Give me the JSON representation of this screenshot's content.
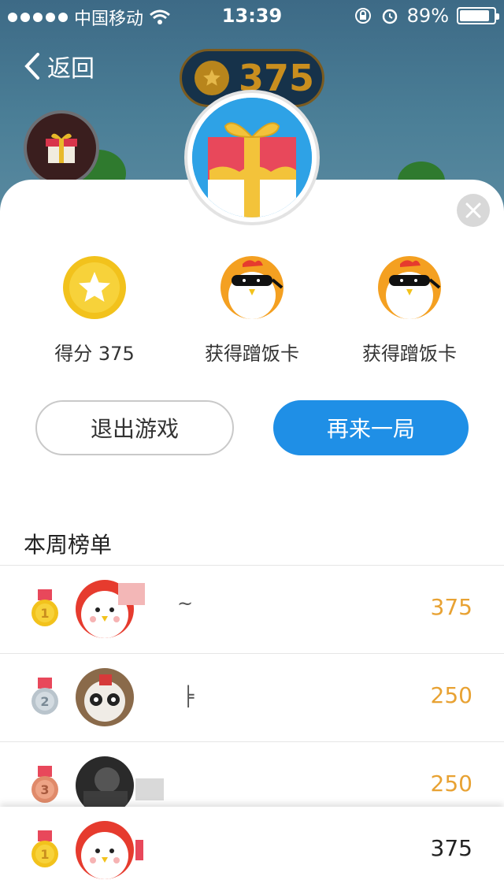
{
  "status_bar": {
    "carrier": "中国移动",
    "time": "13:39",
    "battery": "89%",
    "battery_level": 0.89
  },
  "nav": {
    "back_label": "返回",
    "coin_score": "375"
  },
  "rewards": [
    {
      "label": "得分 375",
      "icon": "star-coin-icon"
    },
    {
      "label": "获得蹭饭卡",
      "icon": "chicken-mask-icon"
    },
    {
      "label": "获得蹭饭卡",
      "icon": "chicken-mask-icon"
    }
  ],
  "buttons": {
    "exit": "退出游戏",
    "again": "再来一局"
  },
  "ranking": {
    "title": "本周榜单",
    "rows": [
      {
        "rank": "1",
        "name": "~",
        "score": "375"
      },
      {
        "rank": "2",
        "name": "╞",
        "score": "250"
      },
      {
        "rank": "3",
        "name": "",
        "score": "250"
      }
    ],
    "me": {
      "rank": "1",
      "score": "375"
    }
  },
  "colors": {
    "primary": "#1f8fe6",
    "score": "#e8a233",
    "gold": "#f2c21c"
  }
}
